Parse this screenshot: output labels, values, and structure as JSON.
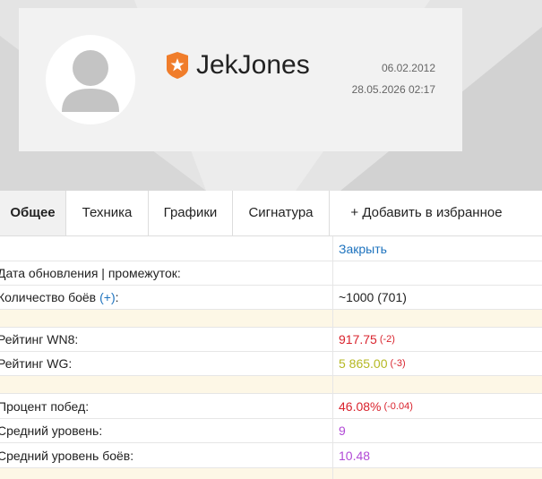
{
  "profile": {
    "username": "JekJones",
    "registered": "06.02.2012",
    "last_seen": "28.05.2026 02:17"
  },
  "tabs": [
    {
      "label": "Общее",
      "active": true
    },
    {
      "label": "Техника",
      "active": false
    },
    {
      "label": "Графики",
      "active": false
    },
    {
      "label": "Сигнатура",
      "active": false
    },
    {
      "label": "+ Добавить в избранное",
      "active": false
    }
  ],
  "stats": {
    "close_label": "Закрыть",
    "update_label": "Дата обновления | промежуток:",
    "battles_label": "Количество боёв",
    "battles_plus": "(+)",
    "battles_colon": ":",
    "battles_value": "~1000 (701)",
    "wn8_label": "Рейтинг WN8:",
    "wn8_value": "917.75",
    "wn8_delta": "(-2)",
    "wg_label": "Рейтинг WG:",
    "wg_value": "5 865.00",
    "wg_delta": "(-3)",
    "winrate_label": "Процент побед:",
    "winrate_value": "46.08%",
    "winrate_delta": "(-0.04)",
    "avg_tier_label": "Средний уровень:",
    "avg_tier_value": "9",
    "avg_battle_tier_label": "Средний уровень боёв:",
    "avg_battle_tier_value": "10.48"
  },
  "colors": {
    "wn8": "#d9232d",
    "wg": "#b5b823",
    "tier": "#b14ad6",
    "link": "#1e73be",
    "badge": "#f07d2b"
  },
  "icons": {
    "badge": "shield-star-icon",
    "avatar": "user-avatar-icon"
  }
}
